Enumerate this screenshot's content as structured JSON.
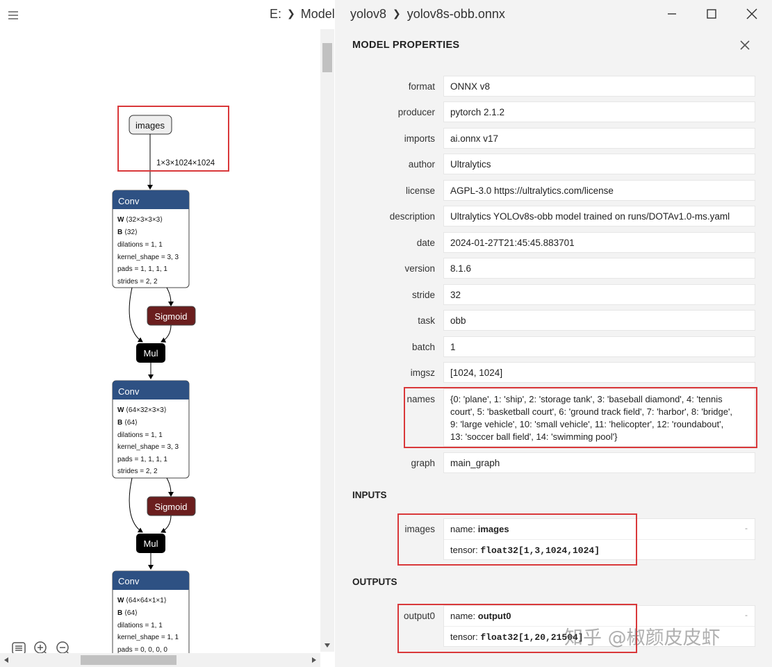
{
  "breadcrumb": {
    "items": [
      "E:",
      "Model",
      "yolov8",
      "yolov8s-obb.onnx"
    ]
  },
  "graph": {
    "input_node": "images",
    "input_shape": "1×3×1024×1024",
    "nodes": [
      {
        "title": "Conv",
        "w": "⟨32×3×3×3⟩",
        "b": "⟨32⟩",
        "attrs": [
          "dilations = 1, 1",
          "kernel_shape = 3, 3",
          "pads = 1, 1, 1, 1",
          "strides = 2, 2"
        ]
      },
      {
        "title": "Conv",
        "w": "⟨64×32×3×3⟩",
        "b": "⟨64⟩",
        "attrs": [
          "dilations = 1, 1",
          "kernel_shape = 3, 3",
          "pads = 1, 1, 1, 1",
          "strides = 2, 2"
        ]
      },
      {
        "title": "Conv",
        "w": "⟨64×64×1×1⟩",
        "b": "⟨64⟩",
        "attrs": [
          "dilations = 1, 1",
          "kernel_shape = 1, 1",
          "pads = 0, 0, 0, 0"
        ]
      }
    ],
    "sigmoid_label": "Sigmoid",
    "mul_label": "Mul",
    "w_label": "W",
    "b_label": "B",
    "colors": {
      "conv": "#2e5183",
      "sigmoid": "#6b1e1e",
      "mul": "#000000",
      "highlight": "#d9383a"
    }
  },
  "properties": {
    "title": "MODEL PROPERTIES",
    "rows": [
      {
        "label": "format",
        "value": "ONNX v8"
      },
      {
        "label": "producer",
        "value": "pytorch 2.1.2"
      },
      {
        "label": "imports",
        "value": "ai.onnx v17"
      },
      {
        "label": "author",
        "value": "Ultralytics"
      },
      {
        "label": "license",
        "value": "AGPL-3.0 https://ultralytics.com/license"
      },
      {
        "label": "description",
        "value": "Ultralytics YOLOv8s-obb model trained on runs/DOTAv1.0-ms.yaml"
      },
      {
        "label": "date",
        "value": "2024-01-27T21:45:45.883701"
      },
      {
        "label": "version",
        "value": "8.1.6"
      },
      {
        "label": "stride",
        "value": "32"
      },
      {
        "label": "task",
        "value": "obb"
      },
      {
        "label": "batch",
        "value": "1"
      },
      {
        "label": "imgsz",
        "value": "[1024, 1024]"
      }
    ],
    "names_label": "names",
    "names_lines": [
      "{0: 'plane', 1: 'ship', 2: 'storage tank', 3: 'baseball diamond', 4: 'tennis",
      "court', 5: 'basketball court', 6: 'ground track field', 7: 'harbor', 8: 'bridge',",
      "9: 'large vehicle', 10: 'small vehicle', 11: 'helicopter', 12: 'roundabout',",
      "13: 'soccer ball field', 14: 'swimming pool'}"
    ],
    "graph_label": "graph",
    "graph_value": "main_graph"
  },
  "inputs": {
    "title": "INPUTS",
    "label": "images",
    "name_prefix": "name:",
    "name_value": "images",
    "tensor_prefix": "tensor:",
    "tensor_value": "float32[1,3,1024,1024]",
    "dash": "-"
  },
  "outputs": {
    "title": "OUTPUTS",
    "label": "output0",
    "name_prefix": "name:",
    "name_value": "output0",
    "tensor_prefix": "tensor:",
    "tensor_value": "float32[1,20,21504]",
    "dash": "-"
  },
  "watermark": "知乎 @椒颜皮皮虾"
}
